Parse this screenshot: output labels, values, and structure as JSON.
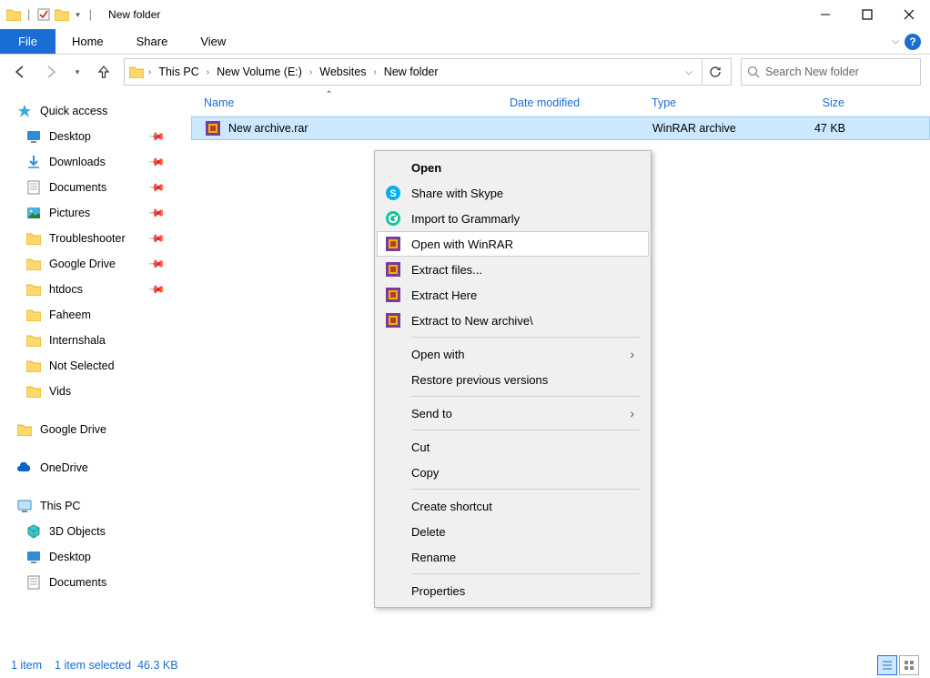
{
  "window": {
    "title": "New folder",
    "separator": "|",
    "tabs": {
      "file": "File",
      "home": "Home",
      "share": "Share",
      "view": "View"
    }
  },
  "breadcrumb": {
    "items": [
      "This PC",
      "New Volume (E:)",
      "Websites",
      "New folder"
    ]
  },
  "search": {
    "placeholder": "Search New folder"
  },
  "columns": {
    "name": "Name",
    "date": "Date modified",
    "type": "Type",
    "size": "Size"
  },
  "file": {
    "name": "New archive.rar",
    "type": "WinRAR archive",
    "size": "47 KB"
  },
  "sidebar": {
    "quick": "Quick access",
    "items": [
      "Desktop",
      "Downloads",
      "Documents",
      "Pictures",
      "Troubleshooter",
      "Google Drive",
      "htdocs",
      "Faheem",
      "Internshala",
      "Not Selected",
      "Vids"
    ],
    "gdrive": "Google Drive",
    "onedrive": "OneDrive",
    "thispc": "This PC",
    "pcitems": [
      "3D Objects",
      "Desktop",
      "Documents"
    ]
  },
  "context": {
    "open": "Open",
    "skype": "Share with Skype",
    "grammarly": "Import to Grammarly",
    "openwinrar": "Open with WinRAR",
    "extractfiles": "Extract files...",
    "extracthere": "Extract Here",
    "extractto": "Extract to New archive\\",
    "openwith": "Open with",
    "restore": "Restore previous versions",
    "sendto": "Send to",
    "cut": "Cut",
    "copy": "Copy",
    "shortcut": "Create shortcut",
    "delete": "Delete",
    "rename": "Rename",
    "properties": "Properties"
  },
  "status": {
    "items": "1 item",
    "selected": "1 item selected",
    "size": "46.3 KB"
  }
}
